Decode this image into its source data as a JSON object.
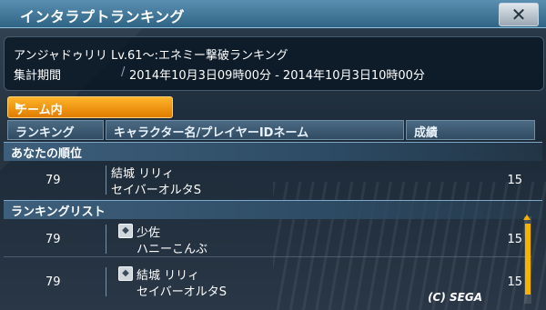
{
  "window": {
    "title": "インタラプトランキング",
    "close_glyph": "✕"
  },
  "info": {
    "event_name": "アンジャドゥリリ Lv.61～:エネミー撃破ランキング",
    "period_label": "集計期間",
    "period_separator": "/",
    "period_value": "2014年10月3日09時00分 - 2014年10月3日10時00分"
  },
  "team_tab": {
    "label": "チーム内",
    "arrow": "▶"
  },
  "columns": {
    "rank": "ランキング",
    "name": "キャラクター名/プレイヤーIDネーム",
    "score": "成績"
  },
  "my_rank": {
    "section_label": "あなたの順位",
    "entry": {
      "rank": "79",
      "character": "結城 リリィ",
      "player": "セイバーオルタS",
      "score": "15"
    }
  },
  "ranking_list": {
    "section_label": "ランキングリスト",
    "entries": [
      {
        "rank": "79",
        "character": "少佐",
        "player": "ハニーこんぶ",
        "score": "15"
      },
      {
        "rank": "79",
        "character": "結城 リリィ",
        "player": "セイバーオルタS",
        "score": "15"
      }
    ]
  },
  "colors": {
    "accent": "#f6b300",
    "titlebar": "#2f6485"
  },
  "footer": {
    "copyright": "(C) SEGA"
  }
}
